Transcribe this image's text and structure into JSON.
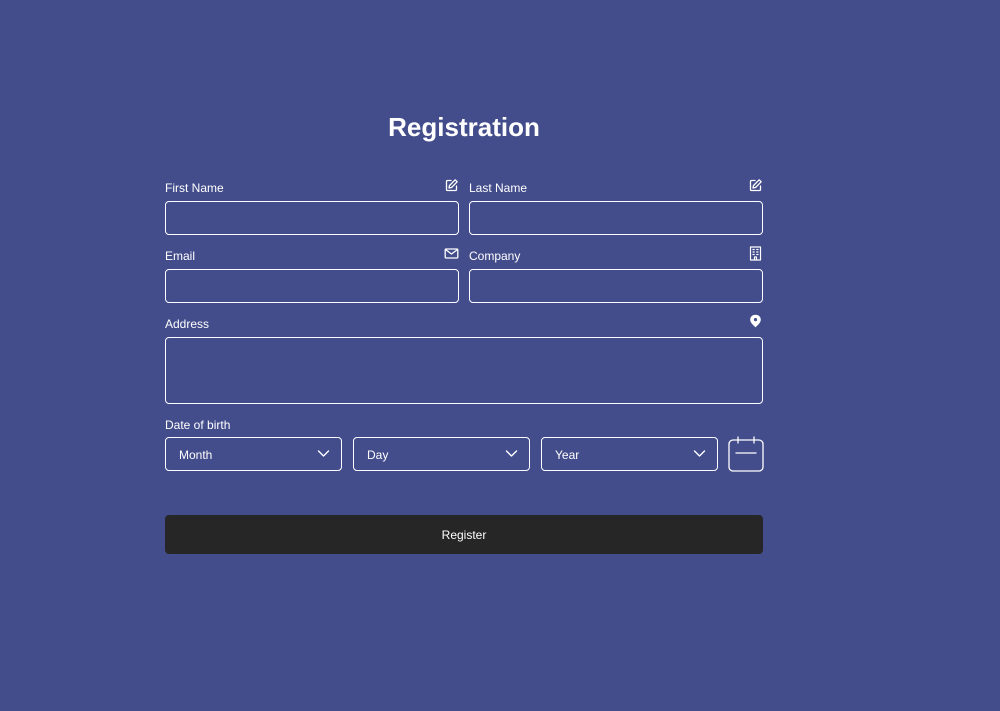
{
  "form": {
    "title": "Registration",
    "fields": {
      "first_name": {
        "label": "First Name",
        "value": "",
        "icon": "edit-icon"
      },
      "last_name": {
        "label": "Last Name",
        "value": "",
        "icon": "edit-icon"
      },
      "email": {
        "label": "Email",
        "value": "",
        "icon": "mail-icon"
      },
      "company": {
        "label": "Company",
        "value": "",
        "icon": "building-icon"
      },
      "address": {
        "label": "Address",
        "value": "",
        "icon": "location-pin-icon"
      }
    },
    "date_of_birth": {
      "label": "Date of birth",
      "month": "Month",
      "day": "Day",
      "year": "Year",
      "icon": "calendar-icon"
    },
    "submit_label": "Register"
  },
  "colors": {
    "background": "#434d8b",
    "field_border": "#ffffff",
    "button_background": "#262626",
    "text": "#ffffff"
  }
}
